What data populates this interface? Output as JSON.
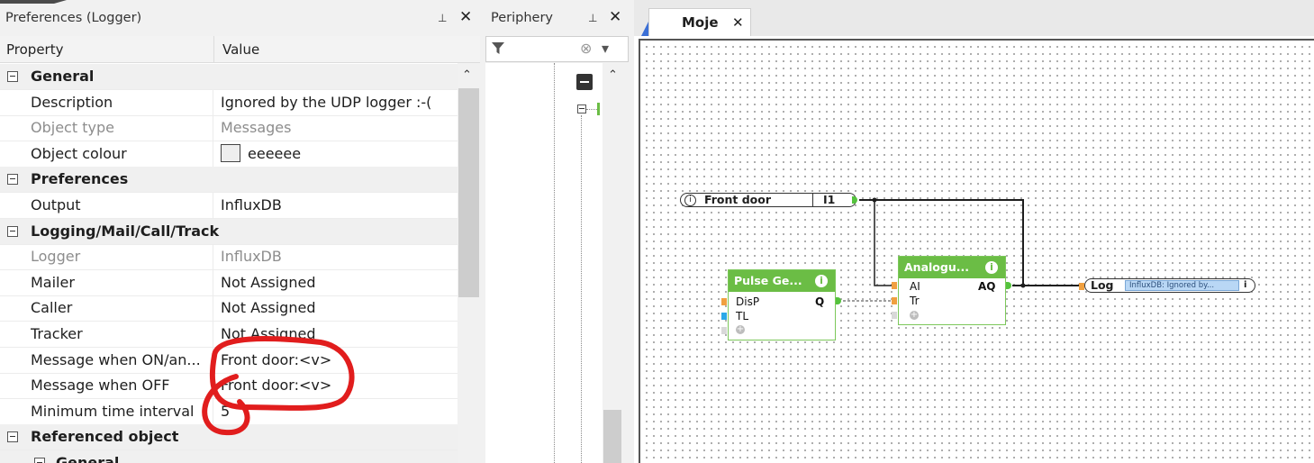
{
  "prefs_panel": {
    "title": "Preferences (Logger)",
    "pin_icon": "⊥",
    "close_icon": "✕",
    "columns": {
      "property": "Property",
      "value": "Value"
    },
    "rows": [
      {
        "type": "category",
        "label": "General"
      },
      {
        "label": "Description",
        "value": "Ignored by the UDP logger :-("
      },
      {
        "label": "Object type",
        "value": "Messages",
        "disabled": true
      },
      {
        "label": "Object colour",
        "value": "eeeeee",
        "swatch": "#eeeeee"
      },
      {
        "type": "category",
        "label": "Preferences"
      },
      {
        "label": "Output",
        "value": "InfluxDB"
      },
      {
        "type": "category",
        "label": "Logging/Mail/Call/Track"
      },
      {
        "label": "Logger",
        "value": "InfluxDB",
        "disabled": true
      },
      {
        "label": "Mailer",
        "value": "Not Assigned"
      },
      {
        "label": "Caller",
        "value": "Not Assigned"
      },
      {
        "label": "Tracker",
        "value": "Not Assigned"
      },
      {
        "label": "Message when ON/an...",
        "value": "Front door:<v>"
      },
      {
        "label": "Message when OFF",
        "value": "Front door:<v>"
      },
      {
        "label": "Minimum time interval",
        "value": "5"
      },
      {
        "type": "category",
        "label": "Referenced object"
      },
      {
        "type": "subcategory",
        "label": "General"
      }
    ]
  },
  "periphery_panel": {
    "title": "Periphery",
    "pin_icon": "⊥",
    "close_icon": "✕",
    "filter_icon": "filter-icon",
    "clear_icon": "⊗",
    "dropdown_icon": "▾"
  },
  "canvas": {
    "tab_label": "Moje",
    "tab_close": "✕",
    "input_block": {
      "label": "Front door",
      "pin": "I1"
    },
    "pulse_block": {
      "title": "Pulse Ge...",
      "inputs": [
        "DisP",
        "TL"
      ],
      "output": "Q"
    },
    "analog_block": {
      "title": "Analogu...",
      "inputs": [
        "AI",
        "Tr"
      ],
      "output": "AQ"
    },
    "log_block": {
      "label": "Log",
      "value": "InfluxDB: Ignored by..."
    },
    "colors": {
      "block_green": "#6bbd45",
      "wire": "#1e1e1e",
      "annotation_red": "#e11d1d",
      "log_blue": "#b9d7f5"
    }
  }
}
